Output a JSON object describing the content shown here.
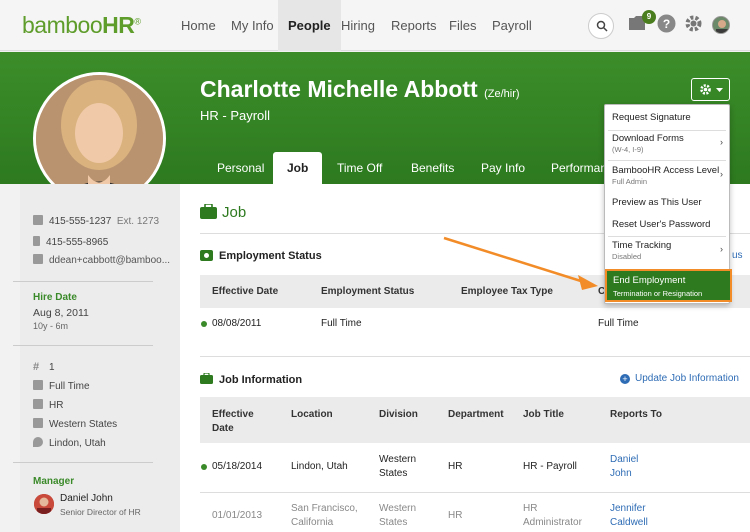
{
  "nav": {
    "logo_main": "bamboo",
    "logo_hr": "HR",
    "logo_mark": "®",
    "items": [
      "Home",
      "My Info",
      "People",
      "Hiring",
      "Reports",
      "Files",
      "Payroll"
    ],
    "inbox_count": "9"
  },
  "profile": {
    "name": "Charlotte Michelle Abbott",
    "pronouns": "(Ze/hir)",
    "job": "HR - Payroll"
  },
  "tabs": [
    "Personal",
    "Job",
    "Time Off",
    "Benefits",
    "Pay Info",
    "Performance"
  ],
  "sidebar": {
    "phone_work": "415-555-1237",
    "phone_ext": "Ext. 1273",
    "phone_mobile": "415-555-8965",
    "email": "ddean+cabbott@bamboo...",
    "hire_label": "Hire Date",
    "hire_date": "Aug 8, 2011",
    "tenure": "10y - 6m",
    "emp_number": "1",
    "status": "Full Time",
    "department": "HR",
    "division": "Western States",
    "location": "Lindon, Utah",
    "manager_label": "Manager",
    "manager_name": "Daniel John",
    "manager_title": "Senior Director of HR"
  },
  "job_section": {
    "title": "Job",
    "employment_status": {
      "title": "Employment Status",
      "columns": [
        "Effective Date",
        "Employment Status",
        "Employee Tax Type",
        "C"
      ],
      "rows": [
        {
          "date": "08/08/2011",
          "status": "Full Time",
          "extra": "Full Time"
        }
      ],
      "partial_link": "us"
    },
    "job_information": {
      "title": "Job Information",
      "update_label": "Update Job Information",
      "columns": [
        "Effective",
        "Date",
        "Location",
        "Division",
        "Department",
        "Job Title",
        "Reports To"
      ],
      "rows": [
        {
          "date": "05/18/2014",
          "location": "Lindon, Utah",
          "division_1": "Western",
          "division_2": "States",
          "department": "HR",
          "job_title": "HR - Payroll",
          "reports_1": "Daniel",
          "reports_2": "John"
        },
        {
          "date": "01/01/2013",
          "location_1": "San Francisco,",
          "location_2": "California",
          "division_1": "Western",
          "division_2": "States",
          "department": "HR",
          "job_title_1": "HR",
          "job_title_2": "Administrator",
          "reports_1": "Jennifer",
          "reports_2": "Caldwell"
        }
      ]
    }
  },
  "dropdown": {
    "items": [
      {
        "label": "Request Signature"
      },
      {
        "label": "Download Forms",
        "sub": "(W-4, I-9)"
      },
      {
        "label": "BambooHR Access Level",
        "sub": "Full Admin"
      },
      {
        "label": "Preview as This User"
      },
      {
        "label": "Reset User's Password"
      },
      {
        "label": "Time Tracking",
        "sub": "Disabled"
      }
    ],
    "end_label": "End Employment",
    "end_sub": "Termination or Resignation"
  },
  "colors": {
    "brand_green": "#2d7a1f",
    "highlight_orange": "#f28c28",
    "link_blue": "#2e6cb5"
  }
}
